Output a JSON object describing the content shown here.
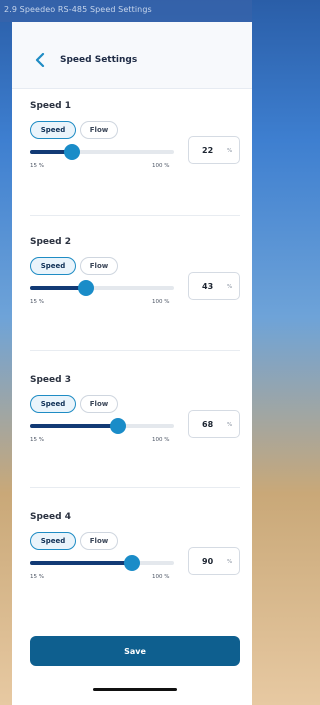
{
  "window": {
    "title": "2.9 Speedeo RS-485 Speed Settings"
  },
  "header": {
    "back_icon": "chevron-left-icon",
    "title": "Speed Settings"
  },
  "sections": [
    {
      "title": "Speed 1",
      "mode_speed_label": "Speed",
      "mode_flow_label": "Flow",
      "selected_mode": "Speed",
      "min_label": "15 %",
      "max_label": "100 %",
      "value": "22",
      "unit": "%",
      "slider_fraction": 0.29
    },
    {
      "title": "Speed 2",
      "mode_speed_label": "Speed",
      "mode_flow_label": "Flow",
      "selected_mode": "Speed",
      "min_label": "15 %",
      "max_label": "100 %",
      "value": "43",
      "unit": "%",
      "slider_fraction": 0.39
    },
    {
      "title": "Speed 3",
      "mode_speed_label": "Speed",
      "mode_flow_label": "Flow",
      "selected_mode": "Speed",
      "min_label": "15 %",
      "max_label": "100 %",
      "value": "68",
      "unit": "%",
      "slider_fraction": 0.61
    },
    {
      "title": "Speed 4",
      "mode_speed_label": "Speed",
      "mode_flow_label": "Flow",
      "selected_mode": "Speed",
      "min_label": "15 %",
      "max_label": "100 %",
      "value": "90",
      "unit": "%",
      "slider_fraction": 0.71
    }
  ],
  "save_label": "Save",
  "colors": {
    "accent": "#1a8cc8",
    "track_fill": "#123a75",
    "save_button": "#0e5f8f"
  }
}
